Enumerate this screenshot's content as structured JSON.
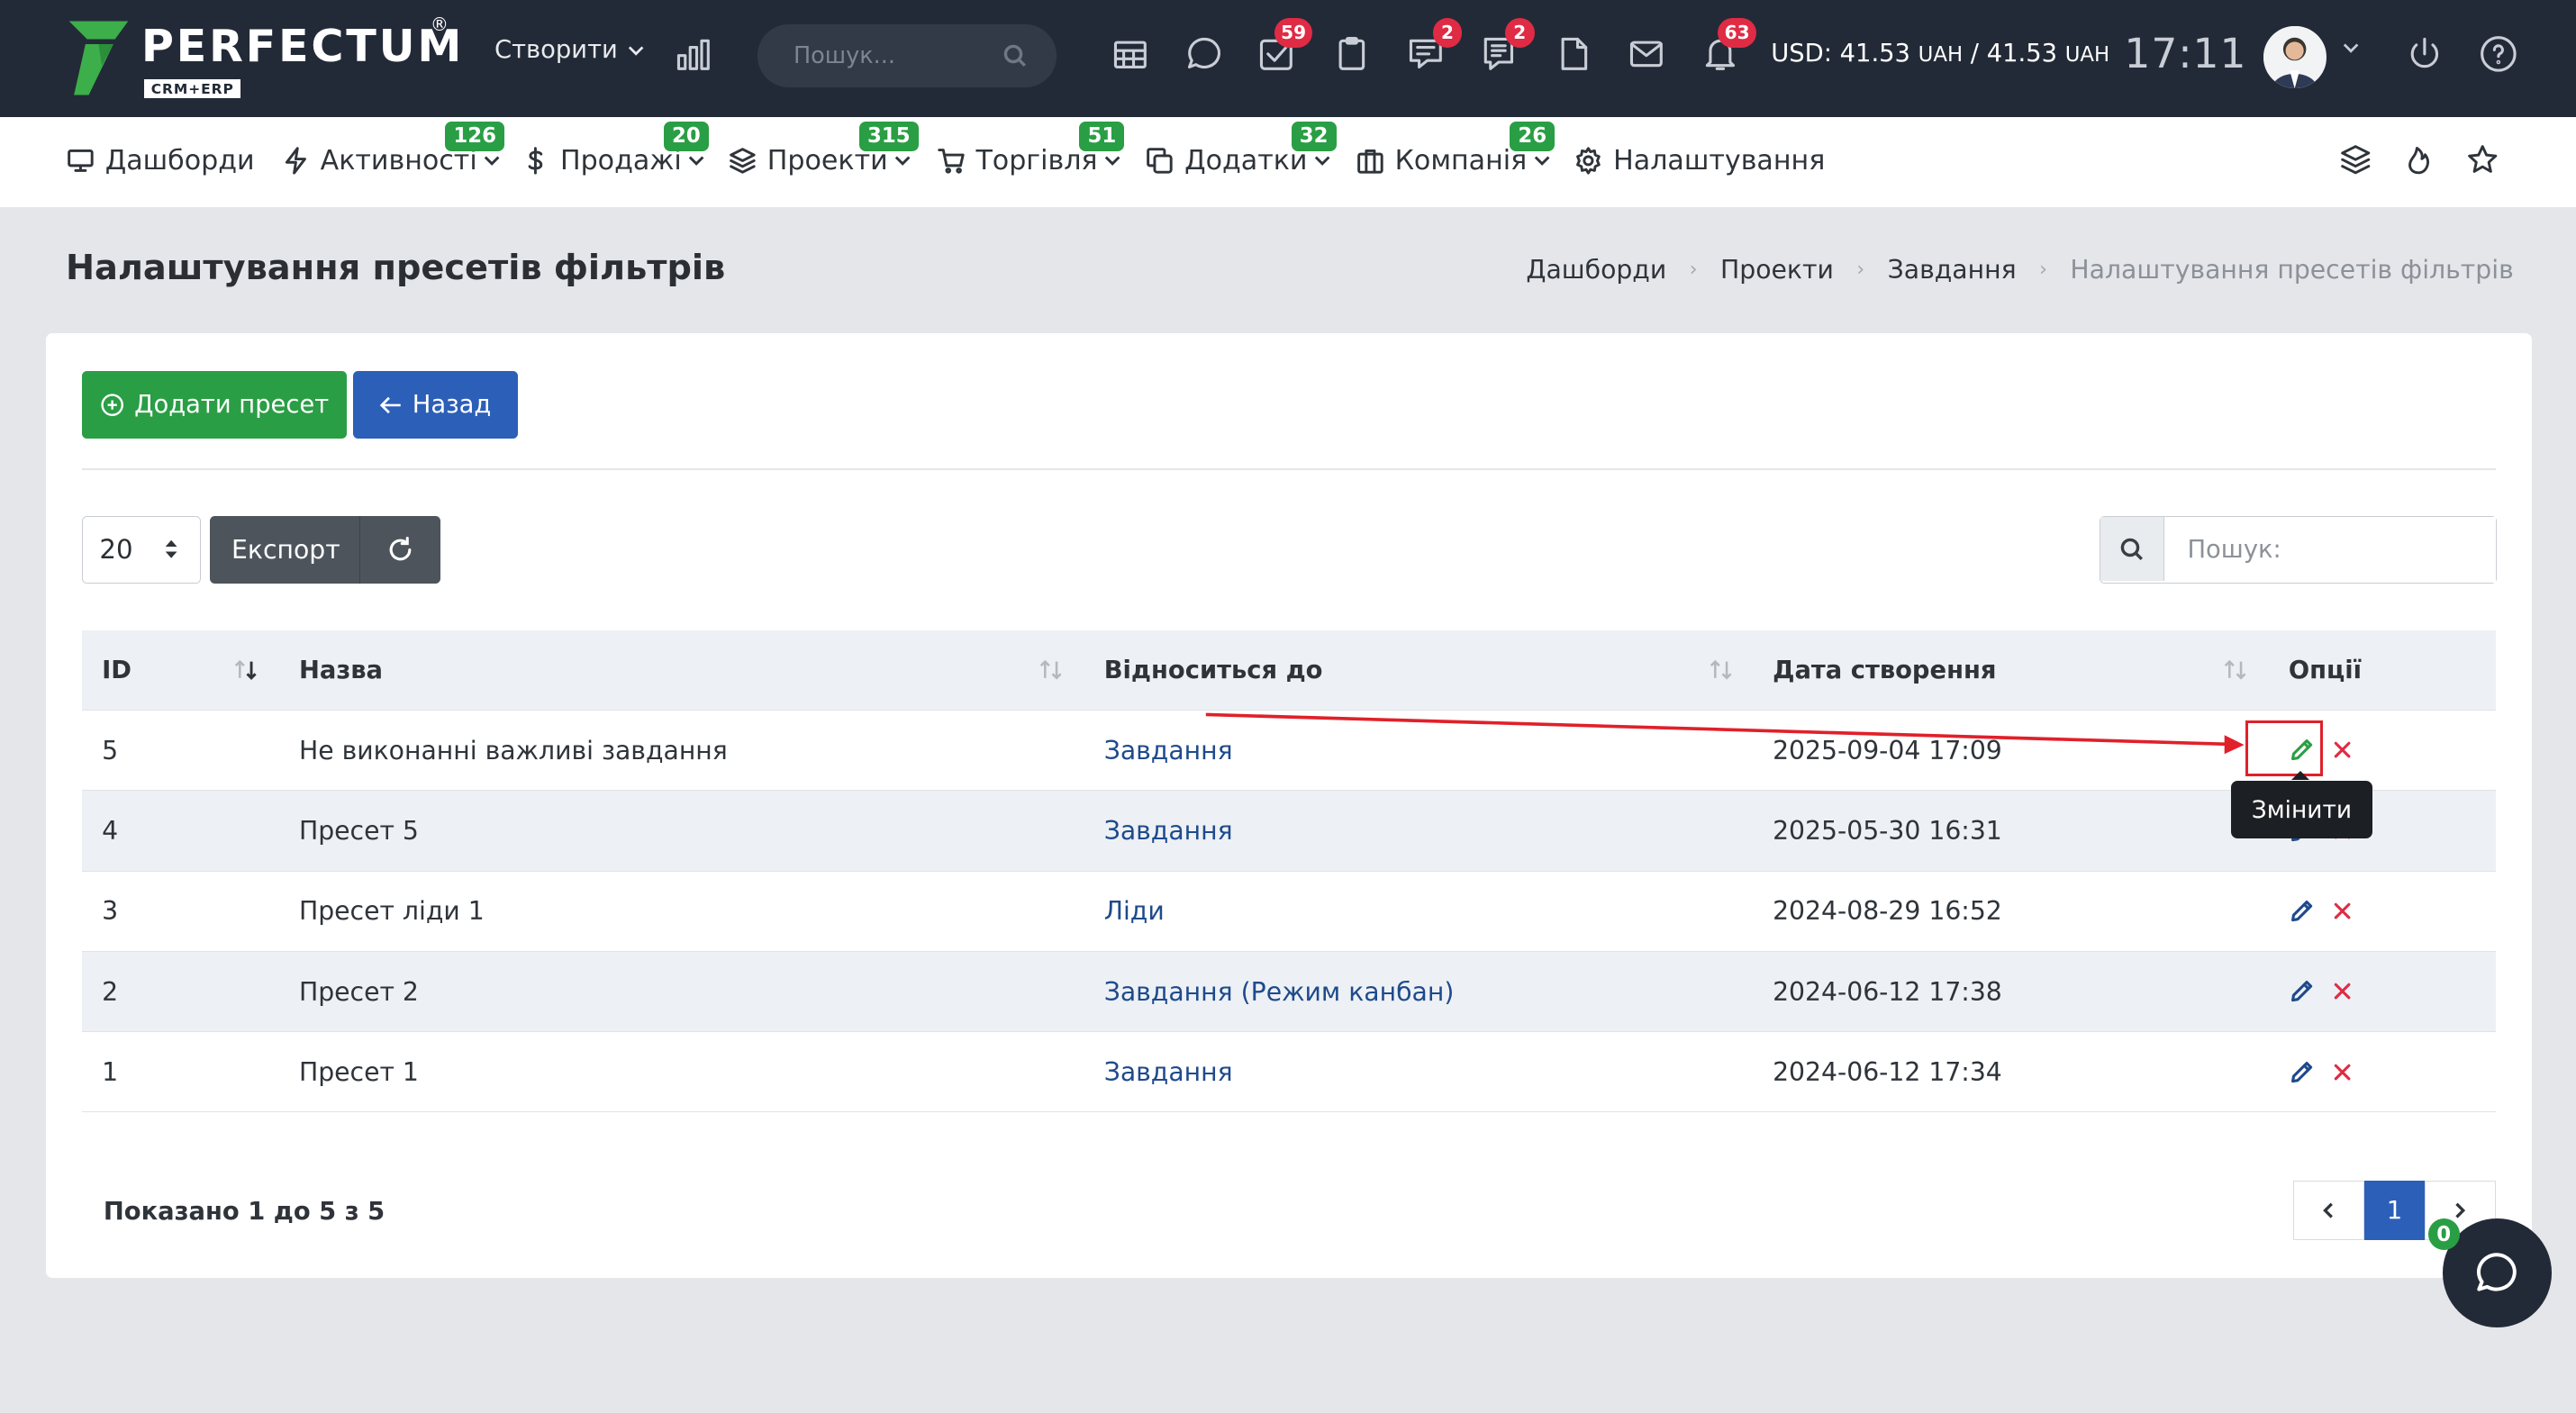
{
  "brand": {
    "name": "PERFECTUM",
    "sub": "CRM+ERP",
    "reg": "®"
  },
  "topbar": {
    "create_label": "Створити",
    "search_placeholder": "Пошук...",
    "badges": {
      "tasks": "59",
      "chat": "2",
      "notes": "2",
      "bell": "63"
    },
    "currency_main": "USD: 41.53",
    "currency_unit1": "UAH",
    "currency_sep": " / 41.53",
    "currency_unit2": "UAH",
    "time": "17:11"
  },
  "nav": {
    "dashboards": "Дашборди",
    "activities": "Активності",
    "activities_badge": "126",
    "sales": "Продажі",
    "sales_badge": "20",
    "projects": "Проекти",
    "projects_badge": "315",
    "trade": "Торгівля",
    "trade_badge": "51",
    "addons": "Додатки",
    "addons_badge": "32",
    "company": "Компанія",
    "company_badge": "26",
    "settings": "Налаштування"
  },
  "page": {
    "title": "Налаштування пресетів фільтрів",
    "breadcrumb": [
      "Дашборди",
      "Проекти",
      "Завдання",
      "Налаштування пресетів фільтрів"
    ]
  },
  "toolbar": {
    "add_label": "Додати пресет",
    "back_label": "Назад",
    "page_size": "20",
    "export_label": "Експорт",
    "search_placeholder": "Пошук:"
  },
  "table": {
    "headers": {
      "id": "ID",
      "name": "Назва",
      "relates": "Відноситься до",
      "created": "Дата створення",
      "options": "Опції"
    },
    "rows": [
      {
        "id": "5",
        "name": "Не виконанні важливі завдання",
        "relates": "Завдання",
        "created": "2025-09-04 17:09"
      },
      {
        "id": "4",
        "name": "Пресет 5",
        "relates": "Завдання",
        "created": "2025-05-30 16:31"
      },
      {
        "id": "3",
        "name": "Пресет ліди 1",
        "relates": "Ліди",
        "created": "2024-08-29 16:52"
      },
      {
        "id": "2",
        "name": "Пресет 2",
        "relates": "Завдання (Режим канбан)",
        "created": "2024-06-12 17:38"
      },
      {
        "id": "1",
        "name": "Пресет 1",
        "relates": "Завдання",
        "created": "2024-06-12 17:34"
      }
    ],
    "tooltip": "Змінити"
  },
  "footer": {
    "info": "Показано 1 до 5 з 5",
    "current_page": "1"
  },
  "chat": {
    "badge": "0"
  },
  "colors": {
    "green": "#2a9e45",
    "blue": "#2c5fb8",
    "topbar": "#232a37",
    "red_badge": "#e02b44",
    "annotation": "#e0202a"
  }
}
